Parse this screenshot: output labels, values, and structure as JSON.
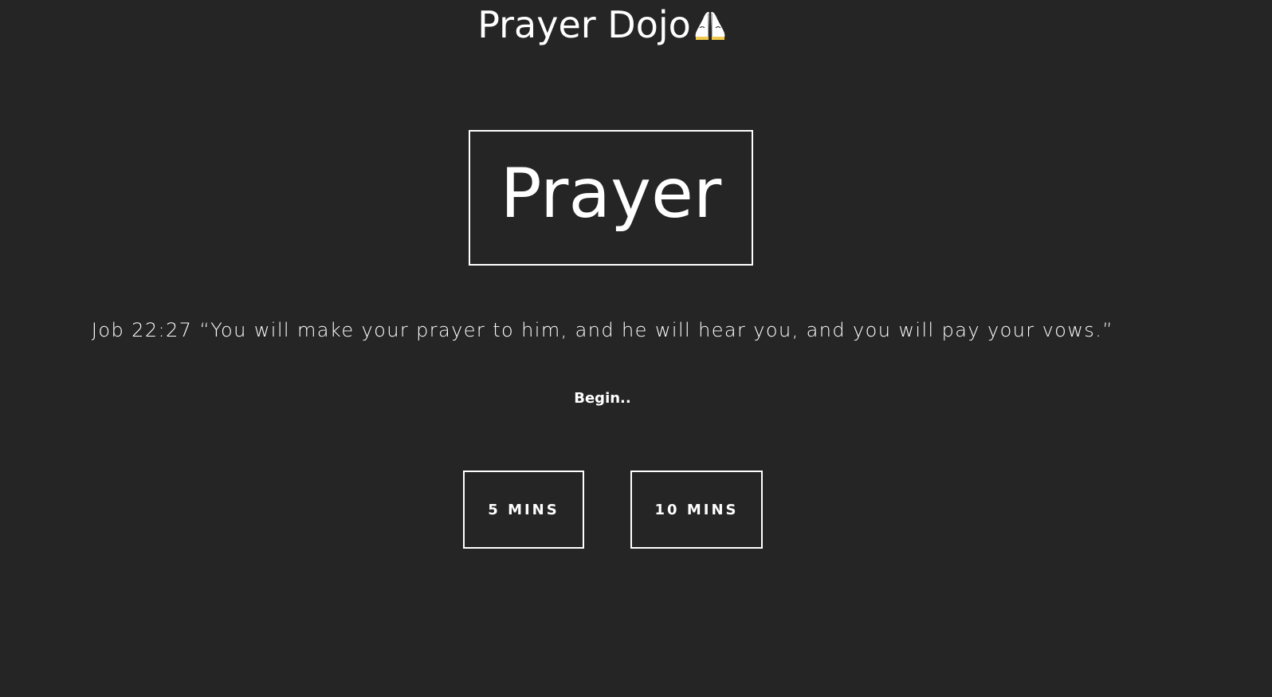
{
  "header": {
    "title": "Prayer Dojo",
    "icon": "praying-hands-icon"
  },
  "hero": {
    "word": "Prayer"
  },
  "verse": {
    "text": "Job 22:27 “You will make your prayer to him, and he will hear you, and you will pay your vows.”"
  },
  "prompt": {
    "text": "Begin.."
  },
  "buttons": {
    "five_label": "5 MINS",
    "ten_label": "10 MINS"
  },
  "colors": {
    "background": "#252525",
    "foreground": "#ffffff"
  }
}
